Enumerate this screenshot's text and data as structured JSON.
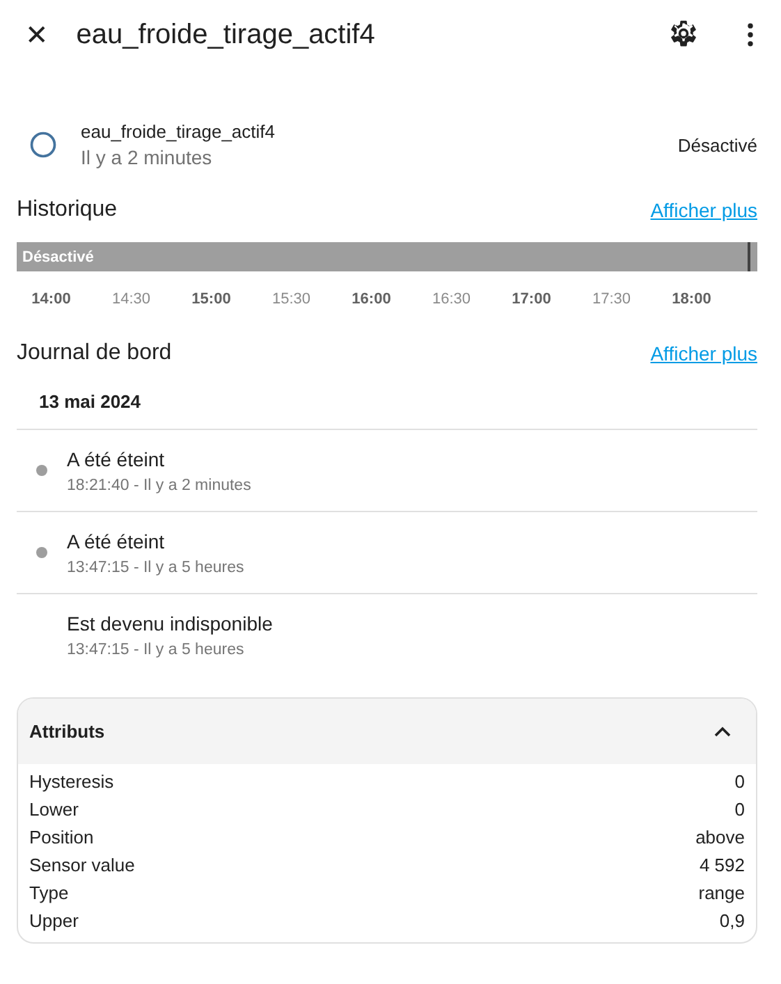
{
  "header": {
    "close": "✕",
    "title": "eau_froide_tirage_actif4"
  },
  "entity": {
    "name": "eau_froide_tirage_actif4",
    "updated": "Il y a 2 minutes",
    "state": "Désactivé"
  },
  "history": {
    "title": "Historique",
    "link": "Afficher plus",
    "bar_label": "Désactivé",
    "ticks": [
      {
        "label": "14:00",
        "major": true
      },
      {
        "label": "14:30",
        "major": false
      },
      {
        "label": "15:00",
        "major": true
      },
      {
        "label": "15:30",
        "major": false
      },
      {
        "label": "16:00",
        "major": true
      },
      {
        "label": "16:30",
        "major": false
      },
      {
        "label": "17:00",
        "major": true
      },
      {
        "label": "17:30",
        "major": false
      },
      {
        "label": "18:00",
        "major": true
      }
    ]
  },
  "logbook": {
    "title": "Journal de bord",
    "link": "Afficher plus",
    "date": "13 mai 2024",
    "entries": [
      {
        "message": "A été éteint",
        "time": "18:21:40 - Il y a 2 minutes",
        "dot": true
      },
      {
        "message": "A été éteint",
        "time": "13:47:15 - Il y a 5 heures",
        "dot": true
      },
      {
        "message": "Est devenu indisponible",
        "time": "13:47:15 - Il y a 5 heures",
        "dot": false
      }
    ]
  },
  "attributes": {
    "title": "Attributs",
    "expanded": true,
    "rows": [
      {
        "name": "Hysteresis",
        "value": "0"
      },
      {
        "name": "Lower",
        "value": "0"
      },
      {
        "name": "Position",
        "value": "above"
      },
      {
        "name": "Sensor value",
        "value": "4 592"
      },
      {
        "name": "Type",
        "value": "range"
      },
      {
        "name": "Upper",
        "value": "0,9"
      }
    ]
  }
}
